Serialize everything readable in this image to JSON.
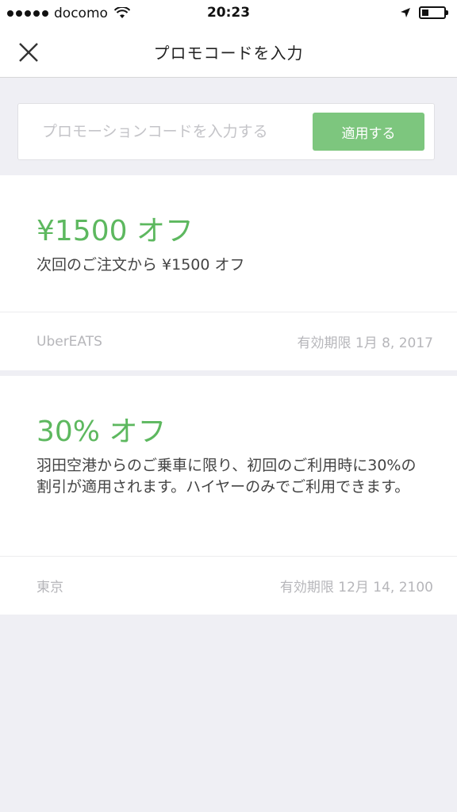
{
  "status_bar": {
    "carrier": "docomo",
    "time": "20:23"
  },
  "nav": {
    "title": "プロモコードを入力"
  },
  "promo": {
    "placeholder": "プロモーションコードを入力する",
    "apply_label": "適用する"
  },
  "promotions": [
    {
      "discount": "¥1500 オフ",
      "description": "次回のご注文から ¥1500 オフ",
      "location": "UberEATS",
      "expiry": "有効期限 1月 8, 2017"
    },
    {
      "discount": "30% オフ",
      "description": "羽田空港からのご乗車に限り、初回のご利用時に30%の割引が適用されます。ハイヤーのみでご利用できます。",
      "location": "東京",
      "expiry": "有効期限 12月 14, 2100"
    }
  ],
  "colors": {
    "accent": "#5db85f",
    "button": "#7dc67e",
    "background": "#efeff4"
  }
}
